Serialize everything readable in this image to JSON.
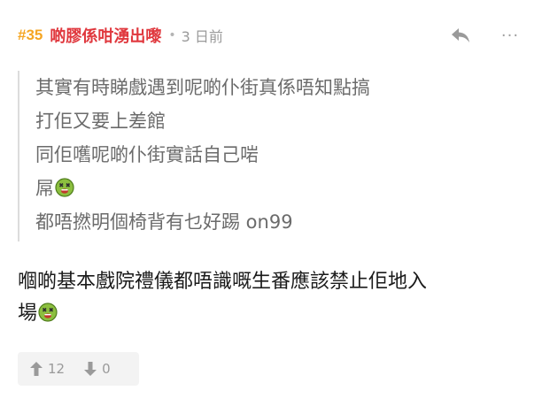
{
  "post": {
    "floor": "#35",
    "username": "啲膠係咁湧出嚟",
    "separator": "•",
    "time": "3 日前",
    "more_label": "···",
    "quote_lines": [
      "其實有時睇戲遇到呢啲仆街真係唔知點搞",
      "打佢又要上差館",
      "同佢嚿呢啲仆街實話自己啱",
      "屌",
      "都唔撚明個椅背有乜好踢 on99"
    ],
    "reply_lines": [
      "嗰啲基本戲院禮儀都唔識嘅生番應該禁止佢地入",
      "場"
    ],
    "icons": {
      "reply": "reply-arrow-icon",
      "more": "more-dots-icon",
      "emoji": "dizzy-face-emoji-icon",
      "upvote": "thumb-up-arrow-icon",
      "downvote": "thumb-down-arrow-icon"
    },
    "colors": {
      "floor": "#f5a623",
      "username": "#e0383e",
      "quote_border": "#dcdcdc",
      "vote_bg": "#f3f3f3"
    },
    "votes": {
      "up": "12",
      "down": "0"
    }
  }
}
